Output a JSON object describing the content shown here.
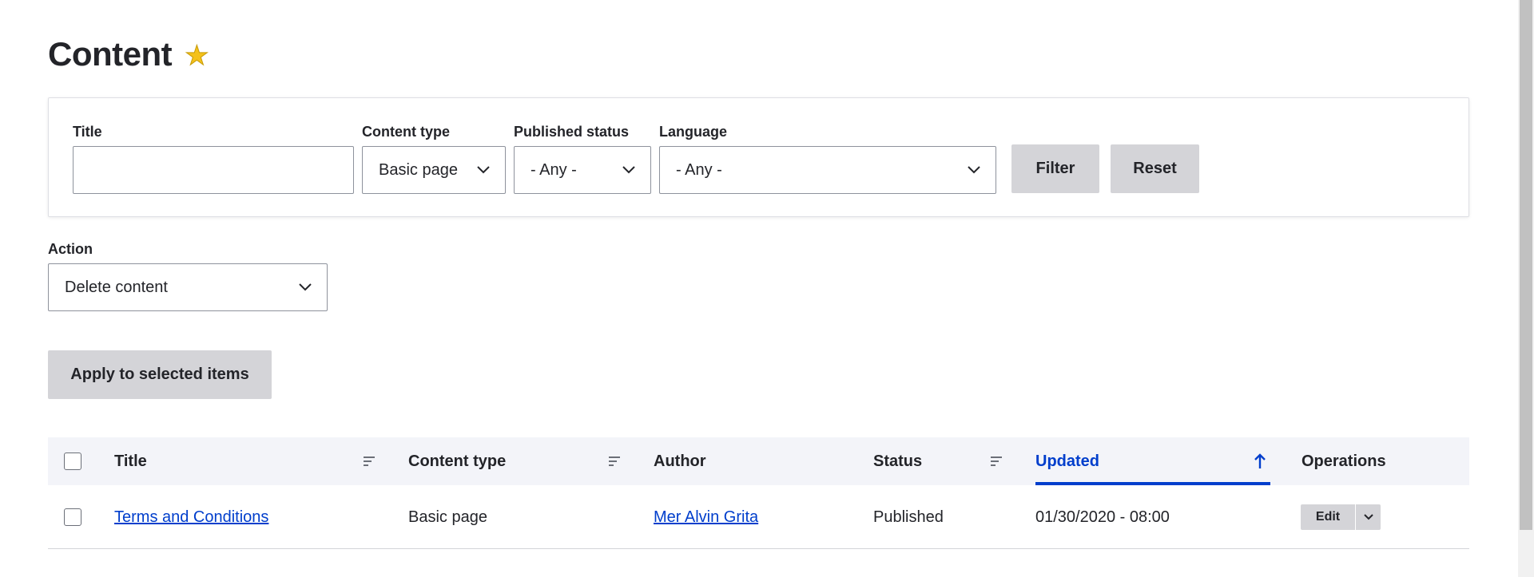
{
  "page": {
    "title": "Content",
    "favorite_icon": "star-icon"
  },
  "filters": {
    "title": {
      "label": "Title",
      "value": ""
    },
    "content_type": {
      "label": "Content type",
      "value": "Basic page"
    },
    "published_status": {
      "label": "Published status",
      "value": "- Any -"
    },
    "language": {
      "label": "Language",
      "value": "- Any -"
    },
    "filter_button": "Filter",
    "reset_button": "Reset"
  },
  "action": {
    "label": "Action",
    "value": "Delete content",
    "apply_button": "Apply to selected items"
  },
  "table": {
    "columns": {
      "title": "Title",
      "content_type": "Content type",
      "author": "Author",
      "status": "Status",
      "updated": "Updated",
      "operations": "Operations"
    },
    "sorted_column": "Updated",
    "sort_direction": "ascending",
    "rows": [
      {
        "title": "Terms and Conditions",
        "content_type": "Basic page",
        "author": "Mer Alvin Grita",
        "status": "Published",
        "updated": "01/30/2020 - 08:00",
        "operation": "Edit"
      }
    ]
  },
  "colors": {
    "accent": "#003ecc",
    "button_bg": "#d4d4d8",
    "header_bg": "#f3f4f9",
    "star": "#f4c11a"
  }
}
